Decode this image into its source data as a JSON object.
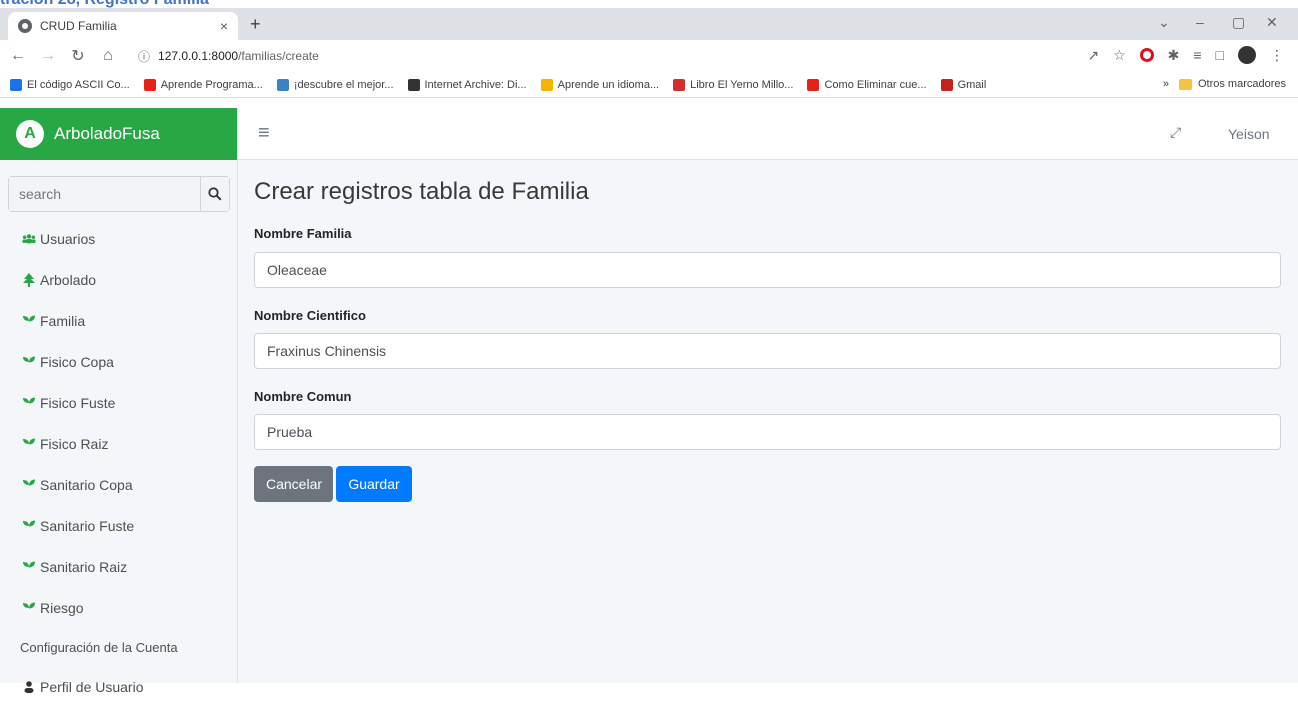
{
  "caption": "tración 28, Registro Familia",
  "browser": {
    "tab_title": "CRUD Familia",
    "tab_close": "×",
    "new_tab": "+",
    "url_host": "127.0.0.1:8000",
    "url_path": "/familias/create",
    "bookmarks": [
      {
        "label": "El código ASCII Co...",
        "color": "#1a73e8"
      },
      {
        "label": "Aprende Programa...",
        "color": "#e62117"
      },
      {
        "label": "¡descubre el mejor...",
        "color": "#3b82c4"
      },
      {
        "label": "Internet Archive: Di...",
        "color": "#333333"
      },
      {
        "label": "Aprende un idioma...",
        "color": "#f4b400"
      },
      {
        "label": "Libro El Yerno Millo...",
        "color": "#d32f2f"
      },
      {
        "label": "Como Eliminar cue...",
        "color": "#e62117"
      },
      {
        "label": "Gmail",
        "color": "#c5221f"
      }
    ],
    "bookmarks_overflow": "»",
    "other_bookmarks": "Otros marcadores"
  },
  "app": {
    "brand": "ArboladoFusa",
    "brand_logo_letter": "A",
    "accent_color": "#28a745",
    "search_placeholder": "search",
    "nav": [
      {
        "label": "Usuarios",
        "icon": "users-icon"
      },
      {
        "label": "Arbolado",
        "icon": "tree-icon"
      },
      {
        "label": "Familia",
        "icon": "seedling-icon"
      },
      {
        "label": "Fisico Copa",
        "icon": "seedling-icon"
      },
      {
        "label": "Fisico Fuste",
        "icon": "seedling-icon"
      },
      {
        "label": "Fisico Raiz",
        "icon": "seedling-icon"
      },
      {
        "label": "Sanitario Copa",
        "icon": "seedling-icon"
      },
      {
        "label": "Sanitario Fuste",
        "icon": "seedling-icon"
      },
      {
        "label": "Sanitario Raiz",
        "icon": "seedling-icon"
      },
      {
        "label": "Riesgo",
        "icon": "seedling-icon"
      }
    ],
    "nav_header": "Configuración de la Cuenta",
    "nav_profile": "Perfil de Usuario",
    "user": "Yeison"
  },
  "form": {
    "title": "Crear registros tabla de Familia",
    "fields": [
      {
        "label": "Nombre Familia",
        "value": "Oleaceae"
      },
      {
        "label": "Nombre Cientifico",
        "value": "Fraxinus Chinensis"
      },
      {
        "label": "Nombre Comun",
        "value": "Prueba"
      }
    ],
    "cancel_label": "Cancelar",
    "save_label": "Guardar"
  }
}
